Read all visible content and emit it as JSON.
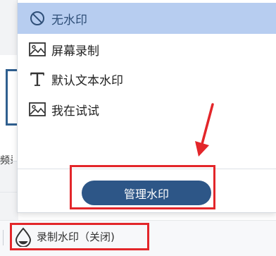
{
  "menu": {
    "items": [
      {
        "label": "无水印",
        "icon": "no-symbol-icon",
        "selected": true
      },
      {
        "label": "屏幕录制",
        "icon": "image-icon",
        "selected": false
      },
      {
        "label": "默认文本水印",
        "icon": "text-icon",
        "selected": false
      },
      {
        "label": "我在试试",
        "icon": "image-icon",
        "selected": false
      }
    ],
    "manage_label": "管理水印"
  },
  "status": {
    "record_watermark_label": "录制水印（关闭)"
  },
  "background": {
    "cut_text": "频录"
  },
  "colors": {
    "selected_bg": "#b7cdf0",
    "button_bg": "#2d5687",
    "annotation_red": "#e3262a"
  }
}
